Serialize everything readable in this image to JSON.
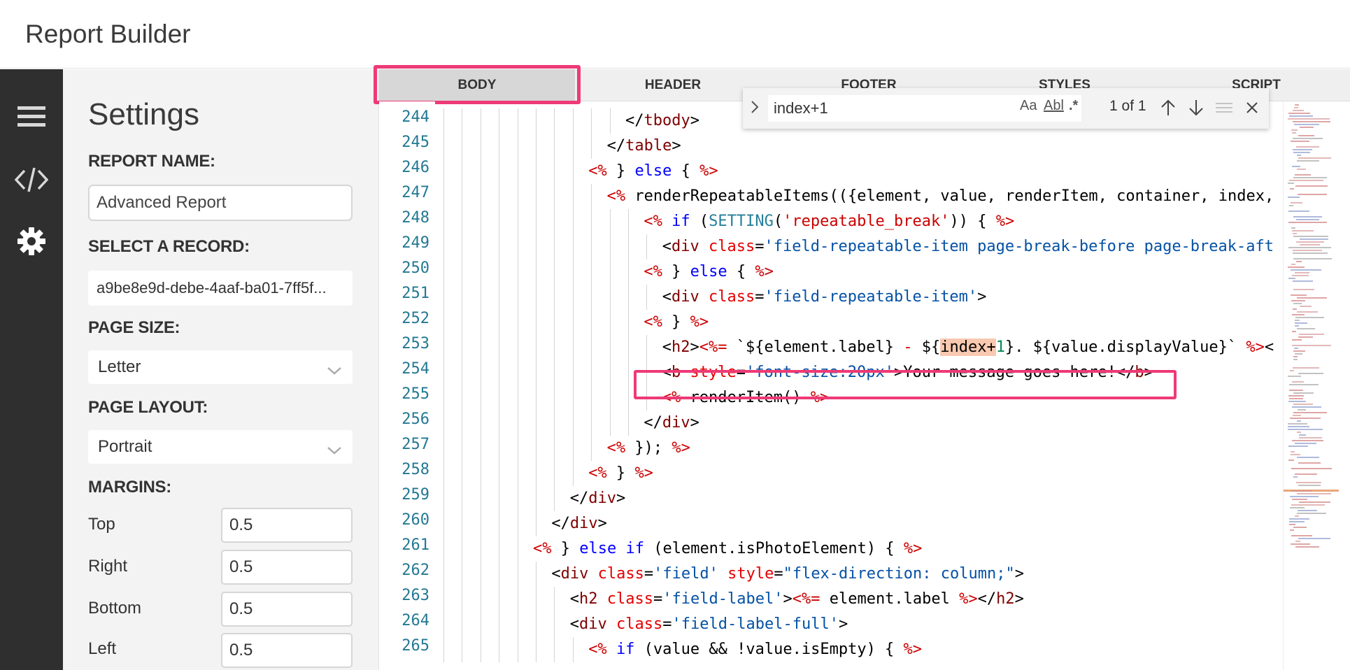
{
  "app": {
    "title": "Report Builder"
  },
  "rail": {
    "icons": [
      "menu-icon",
      "code-icon",
      "gear-icon"
    ]
  },
  "settings": {
    "title": "Settings",
    "report_name_label": "REPORT NAME:",
    "report_name_value": "Advanced Report",
    "record_label": "SELECT A RECORD:",
    "record_value": "a9be8e9d-debe-4aaf-ba01-7ff5f...",
    "page_size_label": "PAGE SIZE:",
    "page_size_value": "Letter",
    "page_layout_label": "PAGE LAYOUT:",
    "page_layout_value": "Portrait",
    "margins_label": "MARGINS:",
    "margins": [
      {
        "label": "Top",
        "value": "0.5"
      },
      {
        "label": "Right",
        "value": "0.5"
      },
      {
        "label": "Bottom",
        "value": "0.5"
      },
      {
        "label": "Left",
        "value": "0.5"
      }
    ]
  },
  "tabs": [
    {
      "label": "BODY",
      "active": true
    },
    {
      "label": "HEADER",
      "active": false
    },
    {
      "label": "FOOTER",
      "active": false
    },
    {
      "label": "STYLES",
      "active": false
    },
    {
      "label": "SCRIPT",
      "active": false
    }
  ],
  "find": {
    "query": "index+1",
    "match_case": "Aa",
    "whole_word": "Abl",
    "regex": ".*",
    "count": "1 of 1"
  },
  "editor": {
    "line_numbers": [
      "244",
      "245",
      "246",
      "247",
      "248",
      "249",
      "250",
      "251",
      "252",
      "253",
      "254",
      "255",
      "256",
      "257",
      "258",
      "259",
      "260",
      "261",
      "262",
      "263",
      "264",
      "265"
    ],
    "code_lines": [
      {
        "indent": 10,
        "tokens": [
          [
            "t-txt",
            "</"
          ],
          [
            "t-tag",
            "tbody"
          ],
          [
            "t-txt",
            ">"
          ]
        ]
      },
      {
        "indent": 9,
        "tokens": [
          [
            "t-txt",
            "</"
          ],
          [
            "t-tag",
            "table"
          ],
          [
            "t-txt",
            ">"
          ]
        ]
      },
      {
        "indent": 8,
        "tokens": [
          [
            "t-del",
            "<%"
          ],
          [
            "t-txt",
            " } "
          ],
          [
            "t-kw",
            "else"
          ],
          [
            "t-txt",
            " { "
          ],
          [
            "t-del",
            "%>"
          ]
        ]
      },
      {
        "indent": 9,
        "tokens": [
          [
            "t-del",
            "<%"
          ],
          [
            "t-txt",
            " renderRepeatableItems(({element, value, renderItem, container, index,"
          ]
        ]
      },
      {
        "indent": 11,
        "tokens": [
          [
            "t-del",
            "<%"
          ],
          [
            "t-txt",
            " "
          ],
          [
            "t-kw",
            "if"
          ],
          [
            "t-txt",
            " ("
          ],
          [
            "t-fn",
            "SETTING"
          ],
          [
            "t-txt",
            "("
          ],
          [
            "t-del",
            "'repeatable_break'"
          ],
          [
            "t-txt",
            ")) { "
          ],
          [
            "t-del",
            "%>"
          ]
        ]
      },
      {
        "indent": 12,
        "tokens": [
          [
            "t-txt",
            "<"
          ],
          [
            "t-tag",
            "div"
          ],
          [
            "t-txt",
            " "
          ],
          [
            "t-attr",
            "class"
          ],
          [
            "t-txt",
            "="
          ],
          [
            "t-str",
            "'field-repeatable-item page-break-before page-break-aft"
          ]
        ]
      },
      {
        "indent": 11,
        "tokens": [
          [
            "t-del",
            "<%"
          ],
          [
            "t-txt",
            " } "
          ],
          [
            "t-kw",
            "else"
          ],
          [
            "t-txt",
            " { "
          ],
          [
            "t-del",
            "%>"
          ]
        ]
      },
      {
        "indent": 12,
        "tokens": [
          [
            "t-txt",
            "<"
          ],
          [
            "t-tag",
            "div"
          ],
          [
            "t-txt",
            " "
          ],
          [
            "t-attr",
            "class"
          ],
          [
            "t-txt",
            "="
          ],
          [
            "t-str",
            "'field-repeatable-item'"
          ],
          [
            "t-txt",
            ">"
          ]
        ]
      },
      {
        "indent": 11,
        "tokens": [
          [
            "t-del",
            "<%"
          ],
          [
            "t-txt",
            " } "
          ],
          [
            "t-del",
            "%>"
          ]
        ]
      },
      {
        "indent": 12,
        "tokens": [
          [
            "t-txt",
            "<"
          ],
          [
            "t-tag",
            "h2"
          ],
          [
            "t-txt",
            ">"
          ],
          [
            "t-del",
            "<%="
          ],
          [
            "t-txt",
            " `${element.label} "
          ],
          [
            "t-del",
            "-"
          ],
          [
            "t-txt",
            " ${"
          ],
          [
            "find-hl",
            "index+"
          ],
          [
            "t-num",
            "1"
          ],
          [
            "t-txt",
            "}. ${value.displayValue}` "
          ],
          [
            "t-del",
            "%>"
          ],
          [
            "t-txt",
            "<"
          ]
        ]
      },
      {
        "indent": 12,
        "tokens": [
          [
            "t-txt",
            "<"
          ],
          [
            "t-tag",
            "b"
          ],
          [
            "t-txt",
            " "
          ],
          [
            "t-attr",
            "style"
          ],
          [
            "t-txt",
            "="
          ],
          [
            "t-str",
            "'font-size:20px'"
          ],
          [
            "t-txt",
            ">Your message goes here!</"
          ],
          [
            "t-tag",
            "b"
          ],
          [
            "t-txt",
            ">"
          ]
        ]
      },
      {
        "indent": 12,
        "tokens": [
          [
            "t-del",
            "<%"
          ],
          [
            "t-txt",
            " renderItem() "
          ],
          [
            "t-del",
            "%>"
          ]
        ]
      },
      {
        "indent": 11,
        "tokens": [
          [
            "t-txt",
            "</"
          ],
          [
            "t-tag",
            "div"
          ],
          [
            "t-txt",
            ">"
          ]
        ]
      },
      {
        "indent": 9,
        "tokens": [
          [
            "t-del",
            "<%"
          ],
          [
            "t-txt",
            " }); "
          ],
          [
            "t-del",
            "%>"
          ]
        ]
      },
      {
        "indent": 8,
        "tokens": [
          [
            "t-del",
            "<%"
          ],
          [
            "t-txt",
            " } "
          ],
          [
            "t-del",
            "%>"
          ]
        ]
      },
      {
        "indent": 7,
        "tokens": [
          [
            "t-txt",
            "</"
          ],
          [
            "t-tag",
            "div"
          ],
          [
            "t-txt",
            ">"
          ]
        ]
      },
      {
        "indent": 6,
        "tokens": [
          [
            "t-txt",
            "</"
          ],
          [
            "t-tag",
            "div"
          ],
          [
            "t-txt",
            ">"
          ]
        ]
      },
      {
        "indent": 5,
        "tokens": [
          [
            "t-del",
            "<%"
          ],
          [
            "t-txt",
            " } "
          ],
          [
            "t-kw",
            "else if"
          ],
          [
            "t-txt",
            " (element.isPhotoElement) { "
          ],
          [
            "t-del",
            "%>"
          ]
        ]
      },
      {
        "indent": 6,
        "tokens": [
          [
            "t-txt",
            "<"
          ],
          [
            "t-tag",
            "div"
          ],
          [
            "t-txt",
            " "
          ],
          [
            "t-attr",
            "class"
          ],
          [
            "t-txt",
            "="
          ],
          [
            "t-str",
            "'field'"
          ],
          [
            "t-txt",
            " "
          ],
          [
            "t-attr",
            "style"
          ],
          [
            "t-txt",
            "="
          ],
          [
            "t-str",
            "\"flex-direction: column;\""
          ],
          [
            "t-txt",
            ">"
          ]
        ]
      },
      {
        "indent": 7,
        "tokens": [
          [
            "t-txt",
            "<"
          ],
          [
            "t-tag",
            "h2"
          ],
          [
            "t-txt",
            " "
          ],
          [
            "t-attr",
            "class"
          ],
          [
            "t-txt",
            "="
          ],
          [
            "t-str",
            "'field-label'"
          ],
          [
            "t-txt",
            ">"
          ],
          [
            "t-del",
            "<%="
          ],
          [
            "t-txt",
            " element.label "
          ],
          [
            "t-del",
            "%>"
          ],
          [
            "t-txt",
            "</"
          ],
          [
            "t-tag",
            "h2"
          ],
          [
            "t-txt",
            ">"
          ]
        ]
      },
      {
        "indent": 7,
        "tokens": [
          [
            "t-txt",
            "<"
          ],
          [
            "t-tag",
            "div"
          ],
          [
            "t-txt",
            " "
          ],
          [
            "t-attr",
            "class"
          ],
          [
            "t-txt",
            "="
          ],
          [
            "t-str",
            "'field-label-full'"
          ],
          [
            "t-txt",
            ">"
          ]
        ]
      },
      {
        "indent": 8,
        "tokens": [
          [
            "t-del",
            "<%"
          ],
          [
            "t-txt",
            " "
          ],
          [
            "t-kw",
            "if"
          ],
          [
            "t-txt",
            " (value && !value.isEmpty) { "
          ],
          [
            "t-del",
            "%>"
          ]
        ]
      }
    ]
  },
  "colors": {
    "accent": "#ee3a76",
    "rail_bg": "#2f2f2f",
    "line_number": "#237893"
  }
}
